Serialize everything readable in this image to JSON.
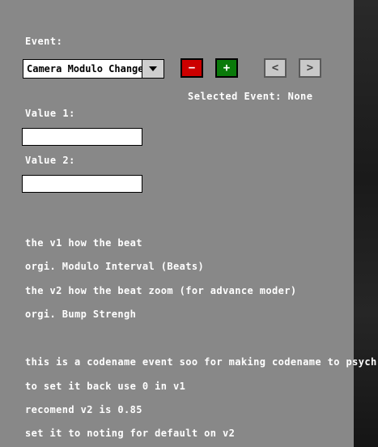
{
  "event_label": "Event:",
  "event_select": {
    "value": "Camera Modulo Change"
  },
  "buttons": {
    "remove": "−",
    "add": "+",
    "prev": "<",
    "next": ">"
  },
  "selected_event": "Selected Event: None",
  "value1": {
    "label": "Value 1:",
    "value": ""
  },
  "value2": {
    "label": "Value 2:",
    "value": ""
  },
  "description": [
    "the v1 how the beat",
    "orgi. Modulo Interval (Beats)",
    "the v2 how the beat zoom (for advance moder)",
    "orgi. Bump Strengh",
    "this is a codename event soo for making codename to psych",
    "to set it back use 0 in v1",
    "recomend v2 is 0.85",
    "set it to noting for default on v2"
  ],
  "colors": {
    "panel": "#888888",
    "remove_button": "#cc0000",
    "add_button": "#0a7a0a",
    "nav_button": "#c8c8c8"
  }
}
